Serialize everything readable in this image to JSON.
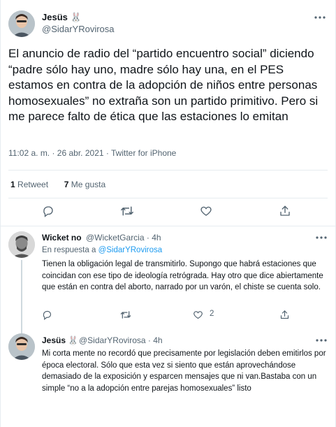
{
  "main_tweet": {
    "author_name": "Jesüs 🐰",
    "author_handle": "@SidarYRovirosa",
    "text": "El anuncio de radio del “partido encuentro social” diciendo “padre sólo hay uno, madre sólo hay una, en el PES estamos en contra de la adopción de niños entre personas homosexuales” no extraña son un partido primitivo. Pero si me parece falto de ética que las estaciones lo emitan",
    "meta": "11:02 a. m. · 26 abr. 2021 · Twitter for iPhone",
    "retweet_count": "1",
    "retweet_label": "Retweet",
    "like_count": "7",
    "like_label": "Me gusta"
  },
  "replies": [
    {
      "author_name": "Wicket no",
      "author_handle": "@WicketGarcia · 4h",
      "reply_prefix": "En respuesta a",
      "reply_to": "@SidarYRovirosa",
      "text": "Tienen la obligación legal de transmitirlo. Supongo que habrá estaciones que coincidan con ese tipo de ideología retrógrada. Hay otro que dice abiertamente que están en contra del aborto, narrado por un varón, el chiste se cuenta solo.",
      "like_count": "2"
    },
    {
      "author_name": "Jesüs 🐰",
      "author_handle": "@SidarYRovirosa · 4h",
      "text": "Mi corta mente no recordó que precisamente por legislación deben emitirlos por época electoral. Sólo que esta vez si siento que están aprovechándose demasiado de la exposición y esparcen mensajes que ni van.Bastaba con un simple “no a la adopción entre parejas homosexuales” listo"
    }
  ],
  "icons": {
    "more": "more-icon",
    "reply": "reply-icon",
    "retweet": "retweet-icon",
    "like": "like-icon",
    "share": "share-icon"
  },
  "colors": {
    "text": "#0f1419",
    "secondary": "#536471",
    "link": "#1d9bf0",
    "border": "#e6ecf0"
  }
}
